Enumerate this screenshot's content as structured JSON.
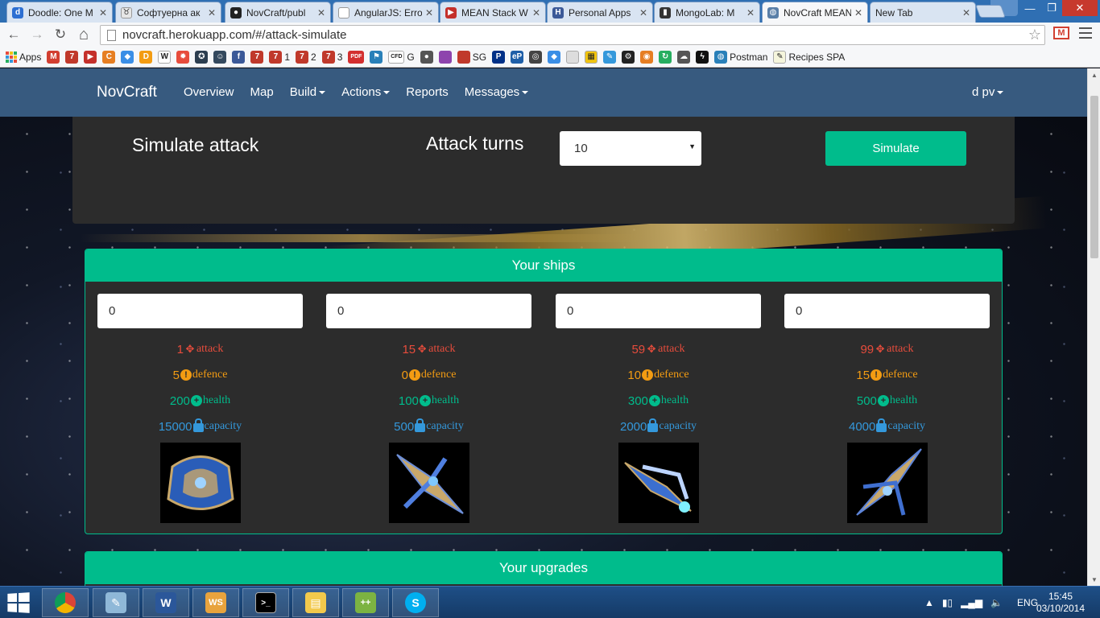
{
  "browser": {
    "tabs": [
      {
        "title": "Doodle: One M",
        "fav_color": "#2d6fd2",
        "fav_glyph": "d"
      },
      {
        "title": "Софтуерна ак",
        "fav_color": "#e6e6e6",
        "fav_glyph": "♉"
      },
      {
        "title": "NovCraft/publ",
        "fav_color": "#222222",
        "fav_glyph": "●"
      },
      {
        "title": "AngularJS: Erro",
        "fav_color": "#ffffff",
        "fav_glyph": ""
      },
      {
        "title": "MEAN Stack W",
        "fav_color": "#c4302b",
        "fav_glyph": "▶"
      },
      {
        "title": "Personal Apps",
        "fav_color": "#3b5998",
        "fav_glyph": "H"
      },
      {
        "title": "MongoLab: M",
        "fav_color": "#333333",
        "fav_glyph": "▮"
      },
      {
        "title": "NovCraft MEAN",
        "fav_color": "#5a7fa8",
        "fav_glyph": "◍"
      },
      {
        "title": "New Tab",
        "fav_color": "",
        "fav_glyph": ""
      }
    ],
    "active_tab_index": 7,
    "url": "novcraft.herokuapp.com/#/attack-simulate",
    "window_controls": {
      "minimize": "—",
      "maximize": "❐",
      "close": "✕"
    },
    "nav": {
      "back": "←",
      "forward": "→",
      "reload": "↻",
      "home": "⌂",
      "star": "☆"
    },
    "gmail_glyph": "M",
    "bookmarks": [
      {
        "label": "Apps",
        "icon": "apps-grid-icon",
        "color": ""
      },
      {
        "label": "",
        "icon": "gmail-icon",
        "color": "#d23f31",
        "glyph": "M"
      },
      {
        "label": "",
        "icon": "seven-icon",
        "color": "#c0392b",
        "glyph": "7"
      },
      {
        "label": "",
        "icon": "youtube-icon",
        "color": "#c4302b",
        "glyph": "▶"
      },
      {
        "label": "",
        "icon": "c-icon",
        "color": "#e67e22",
        "glyph": "C"
      },
      {
        "label": "",
        "icon": "drop-icon",
        "color": "#3a8ee6",
        "glyph": "◆"
      },
      {
        "label": "",
        "icon": "d-icon",
        "color": "#f39c12",
        "glyph": "D"
      },
      {
        "label": "",
        "icon": "wikipedia-icon",
        "color": "#ffffff",
        "glyph": "W"
      },
      {
        "label": "",
        "icon": "burst-icon",
        "color": "#e74c3c",
        "glyph": "✹"
      },
      {
        "label": "",
        "icon": "shield-icon",
        "color": "#2c3e50",
        "glyph": "✪"
      },
      {
        "label": "",
        "icon": "alien-icon",
        "color": "#34495e",
        "glyph": "☺"
      },
      {
        "label": "",
        "icon": "facebook-icon",
        "color": "#3b5998",
        "glyph": "f"
      },
      {
        "label": "",
        "icon": "seven-icon",
        "color": "#c0392b",
        "glyph": "7"
      },
      {
        "label": "1",
        "icon": "seven-icon",
        "color": "#c0392b",
        "glyph": "7"
      },
      {
        "label": "2",
        "icon": "seven-icon",
        "color": "#c0392b",
        "glyph": "7"
      },
      {
        "label": "3",
        "icon": "seven-icon",
        "color": "#c0392b",
        "glyph": "7"
      },
      {
        "label": "",
        "icon": "pdf-icon",
        "color": "#d32f2f",
        "glyph": "PDF"
      },
      {
        "label": "",
        "icon": "flag-icon",
        "color": "#2980b9",
        "glyph": "⚑"
      },
      {
        "label": "G",
        "icon": "cfd-icon",
        "color": "#ffffff",
        "glyph": "CFD"
      },
      {
        "label": "",
        "icon": "circle-icon",
        "color": "#555555",
        "glyph": "●"
      },
      {
        "label": "",
        "icon": "purple-square-icon",
        "color": "#8e44ad",
        "glyph": ""
      },
      {
        "label": "SG",
        "icon": "sg-icon",
        "color": "#c0392b",
        "glyph": ""
      },
      {
        "label": "",
        "icon": "paypal-icon",
        "color": "#003087",
        "glyph": "P"
      },
      {
        "label": "",
        "icon": "ep-icon",
        "color": "#1f5fa8",
        "glyph": "eP"
      },
      {
        "label": "",
        "icon": "target-icon",
        "color": "#444444",
        "glyph": "◎"
      },
      {
        "label": "",
        "icon": "drop-icon",
        "color": "#3a8ee6",
        "glyph": "◆"
      },
      {
        "label": "",
        "icon": "page-icon",
        "color": "#dddddd",
        "glyph": ""
      },
      {
        "label": "",
        "icon": "note-icon",
        "color": "#f1c40f",
        "glyph": "▦"
      },
      {
        "label": "",
        "icon": "pencil-icon",
        "color": "#3498db",
        "glyph": "✎"
      },
      {
        "label": "",
        "icon": "gear-icon",
        "color": "#222222",
        "glyph": "⚙"
      },
      {
        "label": "",
        "icon": "orange-icon",
        "color": "#e67e22",
        "glyph": "◉"
      },
      {
        "label": "",
        "icon": "refresh-icon",
        "color": "#27ae60",
        "glyph": "↻"
      },
      {
        "label": "",
        "icon": "ghost-icon",
        "color": "#555555",
        "glyph": "☁"
      },
      {
        "label": "",
        "icon": "lightning-icon",
        "color": "#111111",
        "glyph": "ϟ"
      },
      {
        "label": "Postman",
        "icon": "globe-icon",
        "color": "#2980b9",
        "glyph": "◍"
      },
      {
        "label": "Recipes SPA",
        "icon": "edit-icon",
        "color": "#f5f5dc",
        "glyph": "✎"
      }
    ]
  },
  "app": {
    "brand": "NovCraft",
    "nav": [
      {
        "label": "Overview",
        "dropdown": false
      },
      {
        "label": "Map",
        "dropdown": false
      },
      {
        "label": "Build",
        "dropdown": true
      },
      {
        "label": "Actions",
        "dropdown": true
      },
      {
        "label": "Reports",
        "dropdown": false
      },
      {
        "label": "Messages",
        "dropdown": true
      }
    ],
    "user": "d pv",
    "simulate": {
      "title": "Simulate attack",
      "turns_label": "Attack turns",
      "turns_value": "10",
      "turns_arrow": "▼",
      "button": "Simulate"
    },
    "ships_heading": "Your ships",
    "stat_labels": {
      "attack": "attack",
      "defence": "defence",
      "health": "health",
      "capacity": "capacity"
    },
    "stat_icons": {
      "attack": "✥",
      "defence": "!",
      "health": "+"
    },
    "ships": [
      {
        "input": "0",
        "attack": "1",
        "defence": "5",
        "health": "200",
        "capacity": "15000",
        "hull": "#2a5db8"
      },
      {
        "input": "0",
        "attack": "15",
        "defence": "0",
        "health": "100",
        "capacity": "500",
        "hull": "#d8c48a"
      },
      {
        "input": "0",
        "attack": "59",
        "defence": "10",
        "health": "300",
        "capacity": "2000",
        "hull": "#3b6fd0"
      },
      {
        "input": "0",
        "attack": "99",
        "defence": "15",
        "health": "500",
        "capacity": "4000",
        "hull": "#cdb27a"
      }
    ],
    "upgrades_heading": "Your upgrades"
  },
  "colors": {
    "accent": "#00bc8c",
    "navbar": "#375a7f",
    "panel": "#2c2c2c",
    "attack": "#e74c3c",
    "defence": "#f39c12",
    "health": "#00bc8c",
    "capacity": "#3498db"
  },
  "taskbar": {
    "items": [
      {
        "name": "chrome",
        "color": "#e8e8e8",
        "glyph": "◉"
      },
      {
        "name": "notepad",
        "color": "#8fb8d8",
        "glyph": "✎"
      },
      {
        "name": "word",
        "color": "#2b579a",
        "glyph": "W"
      },
      {
        "name": "webstorm",
        "color": "#e8a33d",
        "glyph": "WS"
      },
      {
        "name": "cmd",
        "color": "#000000",
        "glyph": ">_"
      },
      {
        "name": "explorer",
        "color": "#f2c94c",
        "glyph": "▤"
      },
      {
        "name": "notepad-plus",
        "color": "#7cb342",
        "glyph": "++"
      },
      {
        "name": "skype",
        "color": "#00aff0",
        "glyph": "S"
      }
    ],
    "tray": {
      "expand": "▲",
      "lang": "ENG"
    },
    "time": "15:45",
    "date": "03/10/2014"
  }
}
